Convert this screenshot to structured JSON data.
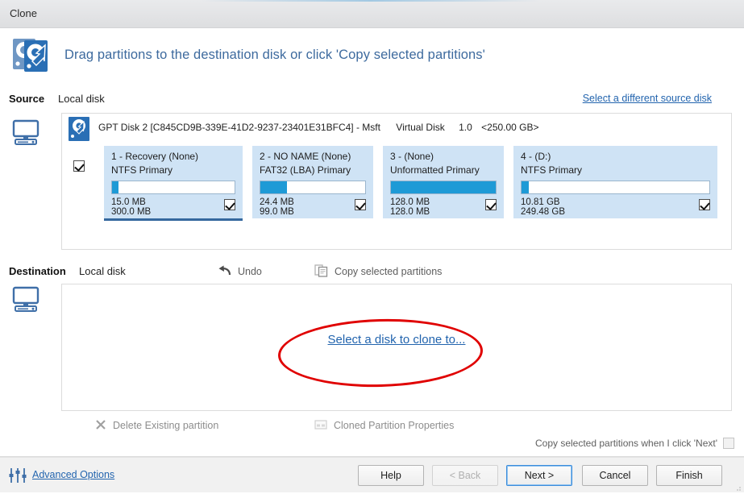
{
  "window": {
    "title": "Clone"
  },
  "banner": {
    "icon": "clone-disks-icon",
    "text": "Drag partitions to the destination disk or click 'Copy selected partitions'"
  },
  "source": {
    "label": "Source",
    "value": "Local disk",
    "different_disk_link": "Select a different source disk",
    "computer_icon": "computer-monitor-icon",
    "disk": {
      "icon": "hard-disk-icon",
      "name": "GPT Disk 2 [C845CD9B-339E-41D2-9237-23401E31BFC4] - Msft",
      "model": "Virtual Disk",
      "revision": "1.0",
      "capacity": "<250.00 GB>",
      "checked": true
    },
    "partitions": [
      {
        "title": "1 - Recovery (None)",
        "filesystem": "NTFS Primary",
        "used": "15.0 MB",
        "total": "300.0 MB",
        "fill_percent": 5,
        "checked": true,
        "selected": true
      },
      {
        "title": "2 - NO NAME (None)",
        "filesystem": "FAT32 (LBA) Primary",
        "used": "24.4 MB",
        "total": "99.0 MB",
        "fill_percent": 25,
        "checked": true,
        "selected": false
      },
      {
        "title": "3 -  (None)",
        "filesystem": "Unformatted Primary",
        "used": "128.0 MB",
        "total": "128.0 MB",
        "fill_percent": 100,
        "checked": true,
        "selected": false
      },
      {
        "title": "4 -  (D:)",
        "filesystem": "NTFS Primary",
        "used": "10.81 GB",
        "total": "249.48 GB",
        "fill_percent": 4,
        "checked": true,
        "selected": false
      }
    ]
  },
  "destination": {
    "label": "Destination",
    "value": "Local disk",
    "computer_icon": "computer-monitor-icon",
    "undo_label": "Undo",
    "undo_icon": "undo-arrow-icon",
    "copy_label": "Copy selected partitions",
    "copy_icon": "copy-pages-icon",
    "select_disk_link": "Select a disk to clone to...",
    "annotation": "red-ellipse-highlight"
  },
  "actions": {
    "delete_partition": "Delete Existing partition",
    "delete_icon": "x-cross-icon",
    "cloned_properties": "Cloned Partition Properties",
    "cloned_icon": "partition-properties-icon",
    "copy_on_next_label": "Copy selected partitions when I click 'Next'",
    "copy_on_next_checked": false
  },
  "footer": {
    "advanced_options": "Advanced Options",
    "advanced_icon": "sliders-icon",
    "buttons": [
      {
        "label": "Help",
        "state": "enabled"
      },
      {
        "label": "< Back",
        "state": "disabled"
      },
      {
        "label": "Next >",
        "state": "focused"
      },
      {
        "label": "Cancel",
        "state": "enabled"
      },
      {
        "label": "Finish",
        "state": "enabled"
      }
    ]
  },
  "colors": {
    "link": "#2264ae",
    "banner_text": "#3d6a9e",
    "partition_bg": "#cfe3f5",
    "fill": "#1e9ad6",
    "annotation": "#e00000",
    "selected_underline": "#35689e"
  }
}
